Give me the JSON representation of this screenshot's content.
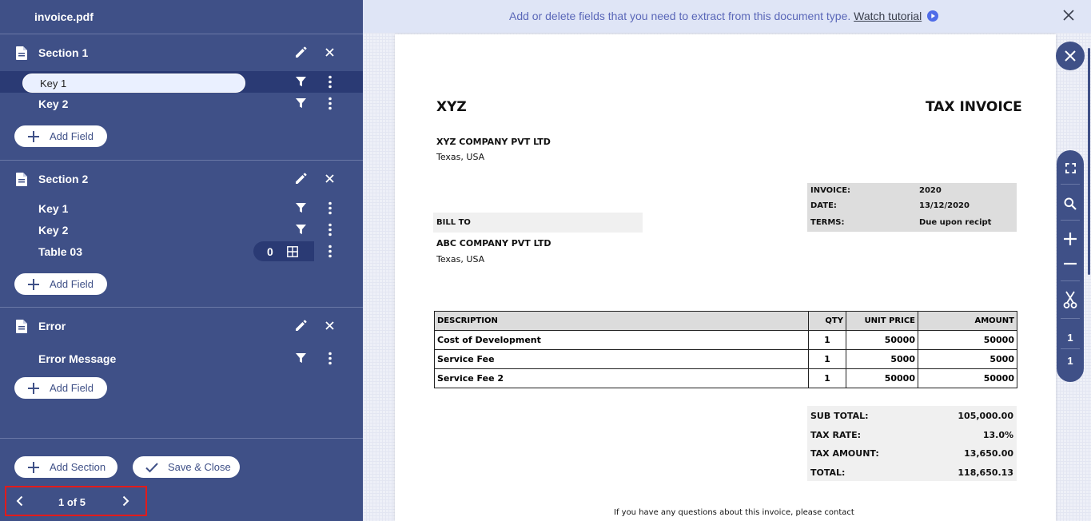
{
  "file": {
    "name": "invoice.pdf"
  },
  "sections": [
    {
      "title": "Section 1",
      "fields": [
        {
          "label": "Key 1",
          "editing": true
        },
        {
          "label": "Key 2"
        }
      ],
      "add_label": "Add Field"
    },
    {
      "title": "Section 2",
      "fields": [
        {
          "label": "Key 1"
        },
        {
          "label": "Key 2"
        },
        {
          "label": "Table 03",
          "type": "table",
          "count": "0"
        }
      ],
      "add_label": "Add Field"
    },
    {
      "title": "Error",
      "fields": [
        {
          "label": "Error Message"
        }
      ],
      "add_label": "Add Field"
    }
  ],
  "footer": {
    "add_section": "Add Section",
    "save_close": "Save & Close",
    "pager": "1 of 5"
  },
  "banner": {
    "message": "Add or delete fields that you need to extract from this document type.",
    "link": "Watch tutorial"
  },
  "toolbar": {
    "page_current": "1",
    "page_total": "1"
  },
  "icons": [
    "document-icon",
    "pencil-icon",
    "close-icon",
    "filter-icon",
    "more-vert-icon",
    "plus-icon",
    "check-icon",
    "chevron-left-icon",
    "chevron-right-icon",
    "table-grid-icon",
    "play-icon",
    "fullscreen-icon",
    "search-icon",
    "zoom-in-icon",
    "zoom-out-icon",
    "scissors-icon"
  ],
  "colors": {
    "sidebar": "#3f5087",
    "selected_row": "#2a3a74",
    "banner": "#dfe5f6",
    "accent": "#5a67b8",
    "highlight_border": "#e21b1b"
  },
  "invoice": {
    "company_short": "XYZ",
    "doc_title": "TAX INVOICE",
    "company_name": "XYZ COMPANY PVT LTD",
    "company_location": "Texas, USA",
    "meta": [
      {
        "label": "INVOICE:",
        "value": "2020"
      },
      {
        "label": "DATE:",
        "value": "13/12/2020"
      },
      {
        "label": "TERMS:",
        "value": "Due upon recipt"
      }
    ],
    "bill_to_label": "BILL TO",
    "bill_to_name": "ABC COMPANY PVT LTD",
    "bill_to_location": "Texas, USA",
    "table": {
      "headers": [
        "DESCRIPTION",
        "QTY",
        "UNIT PRICE",
        "AMOUNT"
      ],
      "rows": [
        [
          "Cost of Development",
          "1",
          "50000",
          "50000"
        ],
        [
          "Service Fee",
          "1",
          "5000",
          "5000"
        ],
        [
          "Service Fee 2",
          "1",
          "50000",
          "50000"
        ]
      ]
    },
    "totals": [
      {
        "label": "SUB TOTAL:",
        "value": "105,000.00"
      },
      {
        "label": "TAX RATE:",
        "value": "13.0%"
      },
      {
        "label": "TAX AMOUNT:",
        "value": "13,650.00"
      },
      {
        "label": "TOTAL:",
        "value": "118,650.13"
      }
    ],
    "footer_note": "If you have any questions about this invoice, please contact"
  }
}
